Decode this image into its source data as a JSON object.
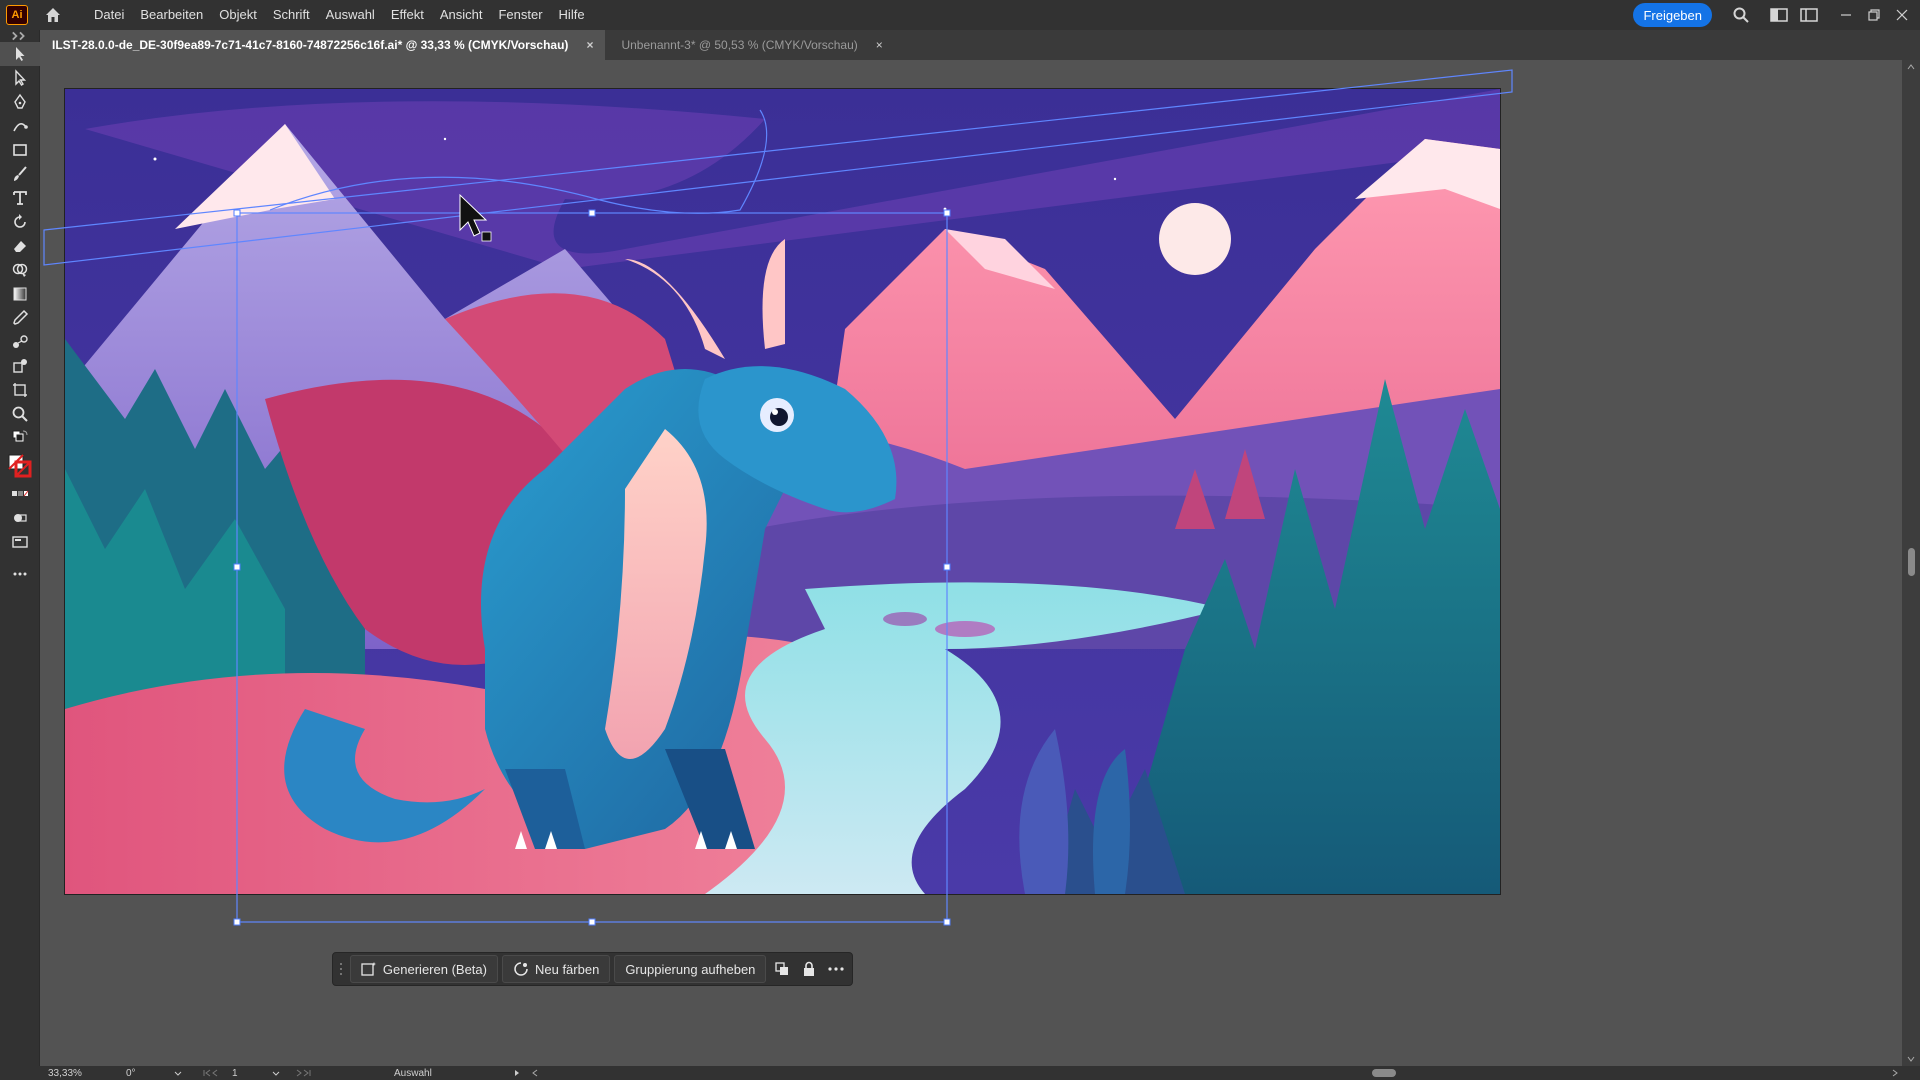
{
  "app": {
    "logo": "Ai",
    "menu": [
      "Datei",
      "Bearbeiten",
      "Objekt",
      "Schrift",
      "Auswahl",
      "Effekt",
      "Ansicht",
      "Fenster",
      "Hilfe"
    ],
    "share_label": "Freigeben"
  },
  "tabs": [
    {
      "title": "ILST-28.0.0-de_DE-30f9ea89-7c71-41c7-8160-74872256c16f.ai* @ 33,33 % (CMYK/Vorschau)",
      "active": true
    },
    {
      "title": "Unbenannt-3* @ 50,53 % (CMYK/Vorschau)",
      "active": false
    }
  ],
  "tab_close_glyph": "×",
  "context_bar": {
    "generate_label": "Generieren (Beta)",
    "recolor_label": "Neu färben",
    "ungroup_label": "Gruppierung aufheben"
  },
  "status": {
    "zoom": "33,33%",
    "rotation": "0°",
    "artboard_number": "1",
    "tool_name": "Auswahl"
  },
  "colors": {
    "ui_dark": "#323232",
    "canvas_bg": "#535353",
    "accent": "#1473e6",
    "selection": "#4f7cff"
  }
}
